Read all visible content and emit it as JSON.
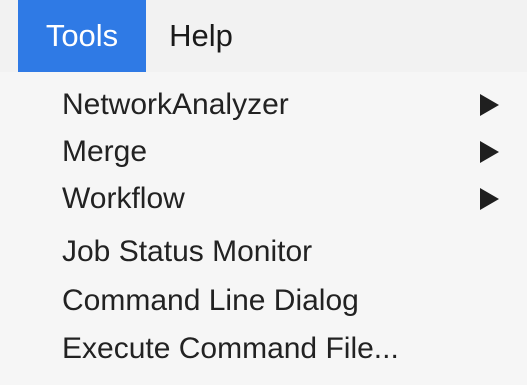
{
  "menubar": {
    "items": [
      {
        "label": "Tools",
        "active": true
      },
      {
        "label": "Help",
        "active": false
      }
    ]
  },
  "tools_menu": {
    "items": [
      {
        "label": "NetworkAnalyzer",
        "has_submenu": true,
        "icon": "submenu-arrow-icon"
      },
      {
        "label": "Merge",
        "has_submenu": true,
        "icon": "submenu-arrow-icon"
      },
      {
        "label": "Workflow",
        "has_submenu": true,
        "icon": "submenu-arrow-icon"
      },
      {
        "label": "Job Status Monitor",
        "has_submenu": false
      },
      {
        "label": "Command Line Dialog",
        "has_submenu": false
      },
      {
        "label": "Execute Command File...",
        "has_submenu": false
      }
    ]
  },
  "colors": {
    "accent": "#2f7ae5",
    "menu_background": "#f6f6f6",
    "text": "#222222"
  }
}
